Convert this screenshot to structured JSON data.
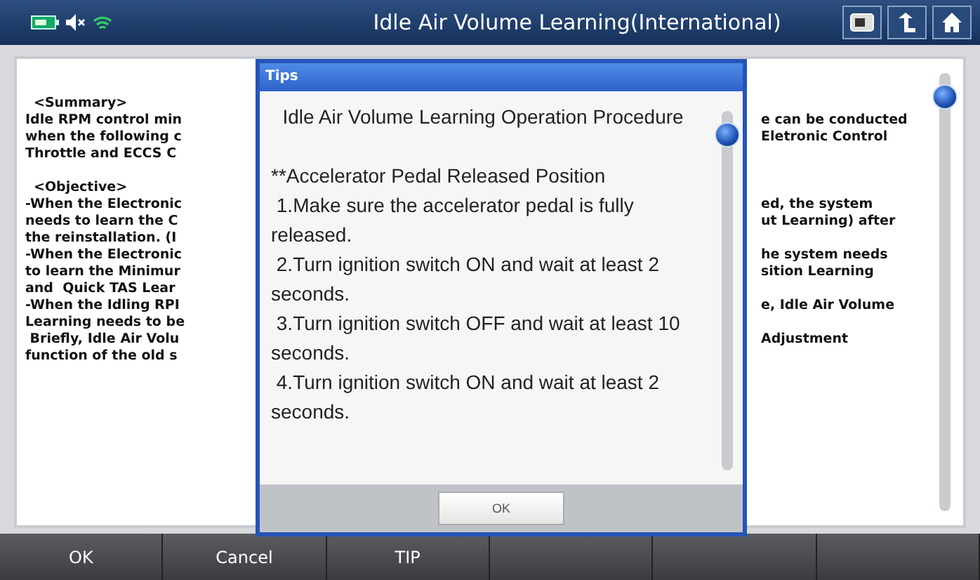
{
  "header": {
    "title": "Idle Air Volume Learning(International)"
  },
  "document": {
    "sections": [
      {
        "lines": [
          {
            "left": "<Summary>"
          },
          {
            "left": "Idle RPM control min",
            "right": "e can be conducted"
          },
          {
            "left": "when the following c",
            "right": "Eletronic Control"
          },
          {
            "left": "Throttle and ECCS C"
          }
        ]
      },
      {
        "lines": [
          {
            "left": "<Objective>"
          },
          {
            "left": "-When the Electronic",
            "right": "ed, the system"
          },
          {
            "left": "needs to learn the C",
            "right": "ut Learning) after"
          },
          {
            "left": "the reinstallation. (I"
          },
          {
            "left": "-When the Electronic",
            "right": "he system needs"
          },
          {
            "left": "to learn the Minimur",
            "right": "sition Learning"
          },
          {
            "left": "and  Quick TAS Lear"
          },
          {
            "left": "-When the Idling RPI",
            "right": "e, Idle Air Volume"
          },
          {
            "left": "Learning needs to be"
          },
          {
            "left": " Briefly, Idle Air Volu",
            "right": "Adjustment"
          },
          {
            "left": "function of the old s"
          }
        ]
      }
    ]
  },
  "dialog": {
    "title": "Tips",
    "paragraphs": [
      {
        "kind": "title",
        "text": "Idle Air Volume Learning Operation Procedure"
      },
      {
        "kind": "heading",
        "text": "**Accelerator Pedal Released Position"
      },
      {
        "kind": "step",
        "text": " 1.Make sure the accelerator pedal is fully released."
      },
      {
        "kind": "step",
        "text": " 2.Turn ignition switch ON and wait at least 2 seconds."
      },
      {
        "kind": "step",
        "text": " 3.Turn ignition switch OFF and wait at least 10 seconds."
      },
      {
        "kind": "step",
        "text": " 4.Turn ignition switch ON and wait at least 2 seconds."
      }
    ],
    "ok_button": "OK"
  },
  "bottom_bar": {
    "buttons": [
      {
        "kind": "label",
        "label": "OK"
      },
      {
        "kind": "label",
        "label": "Cancel"
      },
      {
        "kind": "label",
        "label": "TIP"
      },
      {
        "kind": "blank"
      },
      {
        "kind": "blank"
      },
      {
        "kind": "blank"
      }
    ]
  }
}
